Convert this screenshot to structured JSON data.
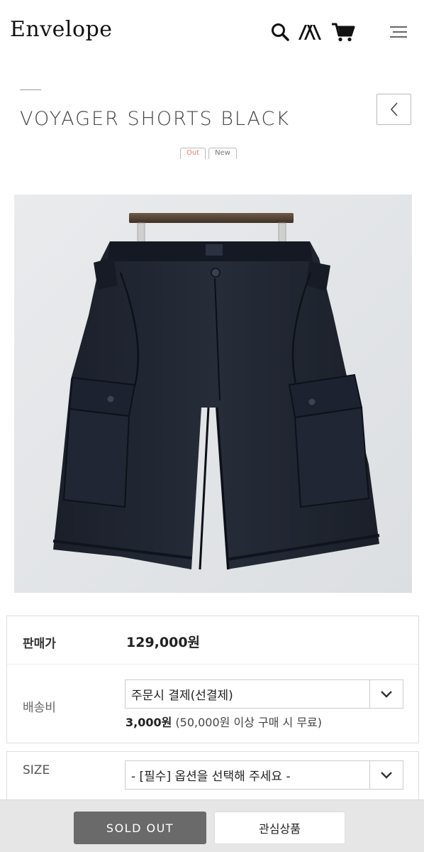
{
  "header": {
    "logo": "Envelope",
    "icons": [
      "search-icon",
      "brand-icon",
      "cart-icon",
      "menu-icon"
    ]
  },
  "product": {
    "title": "VOYAGER SHORTS BLACK",
    "badges": {
      "out": "Out",
      "new": "New"
    },
    "image_subject": "black cargo shorts on hanger"
  },
  "info": {
    "price_label": "판매가",
    "price_value": "129,000원",
    "shipping_label": "배송비",
    "shipping_select": "주문시 결제(선결제)",
    "shipping_fee": "3,000원",
    "shipping_note": "(50,000원 이상 구매 시 무료)",
    "size_label": "SIZE",
    "size_select": "- [필수] 옵션을 선택해 주세요 -"
  },
  "actions": {
    "soldout": "SOLD OUT",
    "wishlist": "관심상품"
  },
  "colors": {
    "soldout_bg": "#6a6a6a",
    "out_badge": "#e07a7a",
    "bar_bg": "#e6e6e6"
  }
}
